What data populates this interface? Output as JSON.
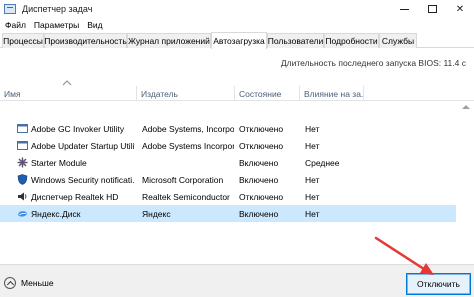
{
  "window": {
    "title": "Диспетчер задач"
  },
  "menu": [
    "Файл",
    "Параметры",
    "Вид"
  ],
  "tabs": [
    {
      "label": "Процессы",
      "active": false
    },
    {
      "label": "Производительность",
      "active": false
    },
    {
      "label": "Журнал приложений",
      "active": false
    },
    {
      "label": "Автозагрузка",
      "active": true
    },
    {
      "label": "Пользователи",
      "active": false
    },
    {
      "label": "Подробности",
      "active": false
    },
    {
      "label": "Службы",
      "active": false
    }
  ],
  "bios_line": "Длительность последнего запуска BIOS: 11.4 с",
  "columns": [
    "Имя",
    "Издатель",
    "Состояние",
    "Влияние на за..."
  ],
  "rows": [
    {
      "name": "Adobe GC Invoker Utility",
      "publisher": "Adobe Systems, Incorpo...",
      "state": "Отключено",
      "impact": "Нет",
      "icon": "app-window-icon",
      "selected": false
    },
    {
      "name": "Adobe Updater Startup Utility",
      "publisher": "Adobe Systems Incorpor...",
      "state": "Отключено",
      "impact": "Нет",
      "icon": "app-window-icon",
      "selected": false
    },
    {
      "name": "Starter Module",
      "publisher": "",
      "state": "Включено",
      "impact": "Среднее",
      "icon": "starter-icon",
      "selected": false
    },
    {
      "name": "Windows Security notificati...",
      "publisher": "Microsoft Corporation",
      "state": "Включено",
      "impact": "Нет",
      "icon": "shield-icon",
      "selected": false
    },
    {
      "name": "Диспетчер Realtek HD",
      "publisher": "Realtek Semiconductor",
      "state": "Отключено",
      "impact": "Нет",
      "icon": "speaker-icon",
      "selected": false
    },
    {
      "name": "Яндекс.Диск",
      "publisher": "Яндекс",
      "state": "Включено",
      "impact": "Нет",
      "icon": "yandex-disk-icon",
      "selected": true
    }
  ],
  "footer": {
    "less_label": "Меньше",
    "disable_label": "Отключить"
  },
  "colors": {
    "selection": "#cce8ff",
    "accent": "#0078d7",
    "annotation_arrow": "#e53935"
  }
}
